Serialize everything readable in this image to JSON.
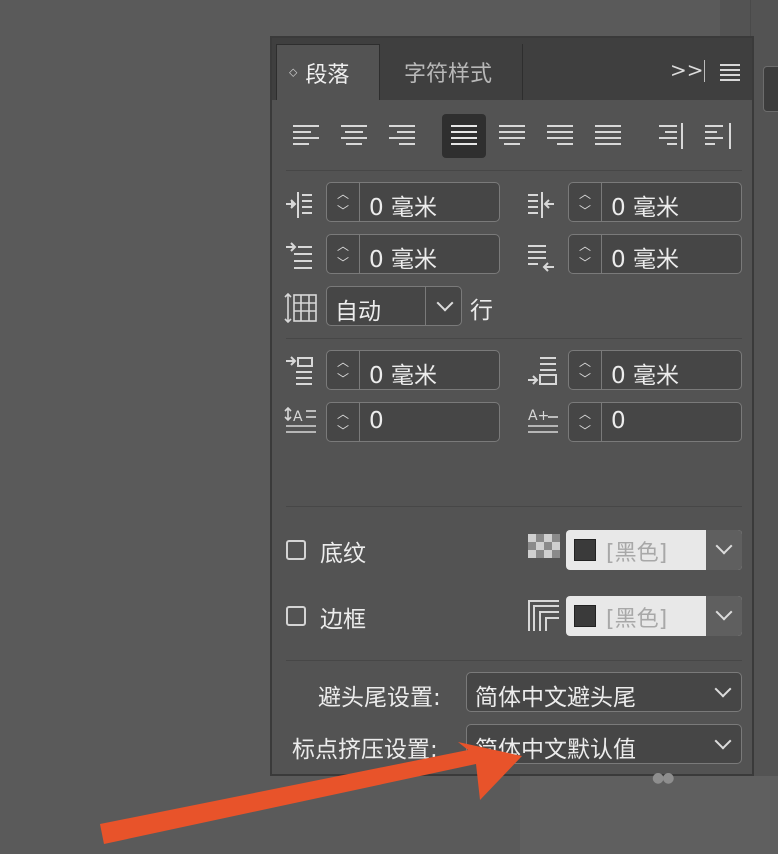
{
  "panel": {
    "tabs": [
      {
        "label": "段落",
        "active": true
      },
      {
        "label": "字符样式",
        "active": false
      }
    ],
    "collapse_glyph": ">>",
    "menu_icon": "hamburger-menu-icon"
  },
  "alignment_buttons": [
    {
      "icon": "align-left-icon",
      "selected": false
    },
    {
      "icon": "align-center-icon",
      "selected": false
    },
    {
      "icon": "align-right-icon",
      "selected": false
    },
    {
      "icon": "justify-left-icon",
      "selected": true
    },
    {
      "icon": "justify-center-icon",
      "selected": false
    },
    {
      "icon": "justify-right-icon",
      "selected": false
    },
    {
      "icon": "justify-all-icon",
      "selected": false
    },
    {
      "icon": "align-towards-spine-icon",
      "selected": false
    },
    {
      "icon": "align-away-from-spine-icon",
      "selected": false
    }
  ],
  "indents": {
    "left_indent": "0 毫米",
    "right_indent": "0 毫米",
    "first_line_indent": "0 毫米",
    "last_line_right_indent": "0 毫米"
  },
  "grid": {
    "value": "自动",
    "unit_label": "行"
  },
  "spacing": {
    "space_before": "0 毫米",
    "space_after": "0 毫米",
    "drop_cap_lines": "0",
    "drop_cap_chars": "0"
  },
  "shading": {
    "label": "底纹",
    "checked": false,
    "color": "[黑色]"
  },
  "border": {
    "label": "边框",
    "checked": false,
    "color": "[黑色]"
  },
  "kinsoku": {
    "label": "避头尾设置:",
    "value": "简体中文避头尾"
  },
  "mojikumi": {
    "label": "标点挤压设置:",
    "value": "简体中文默认值"
  },
  "colors": {
    "panel_bg": "#535353",
    "tabbar_bg": "#3f3f3f",
    "annotation_arrow": "#e8532a"
  }
}
